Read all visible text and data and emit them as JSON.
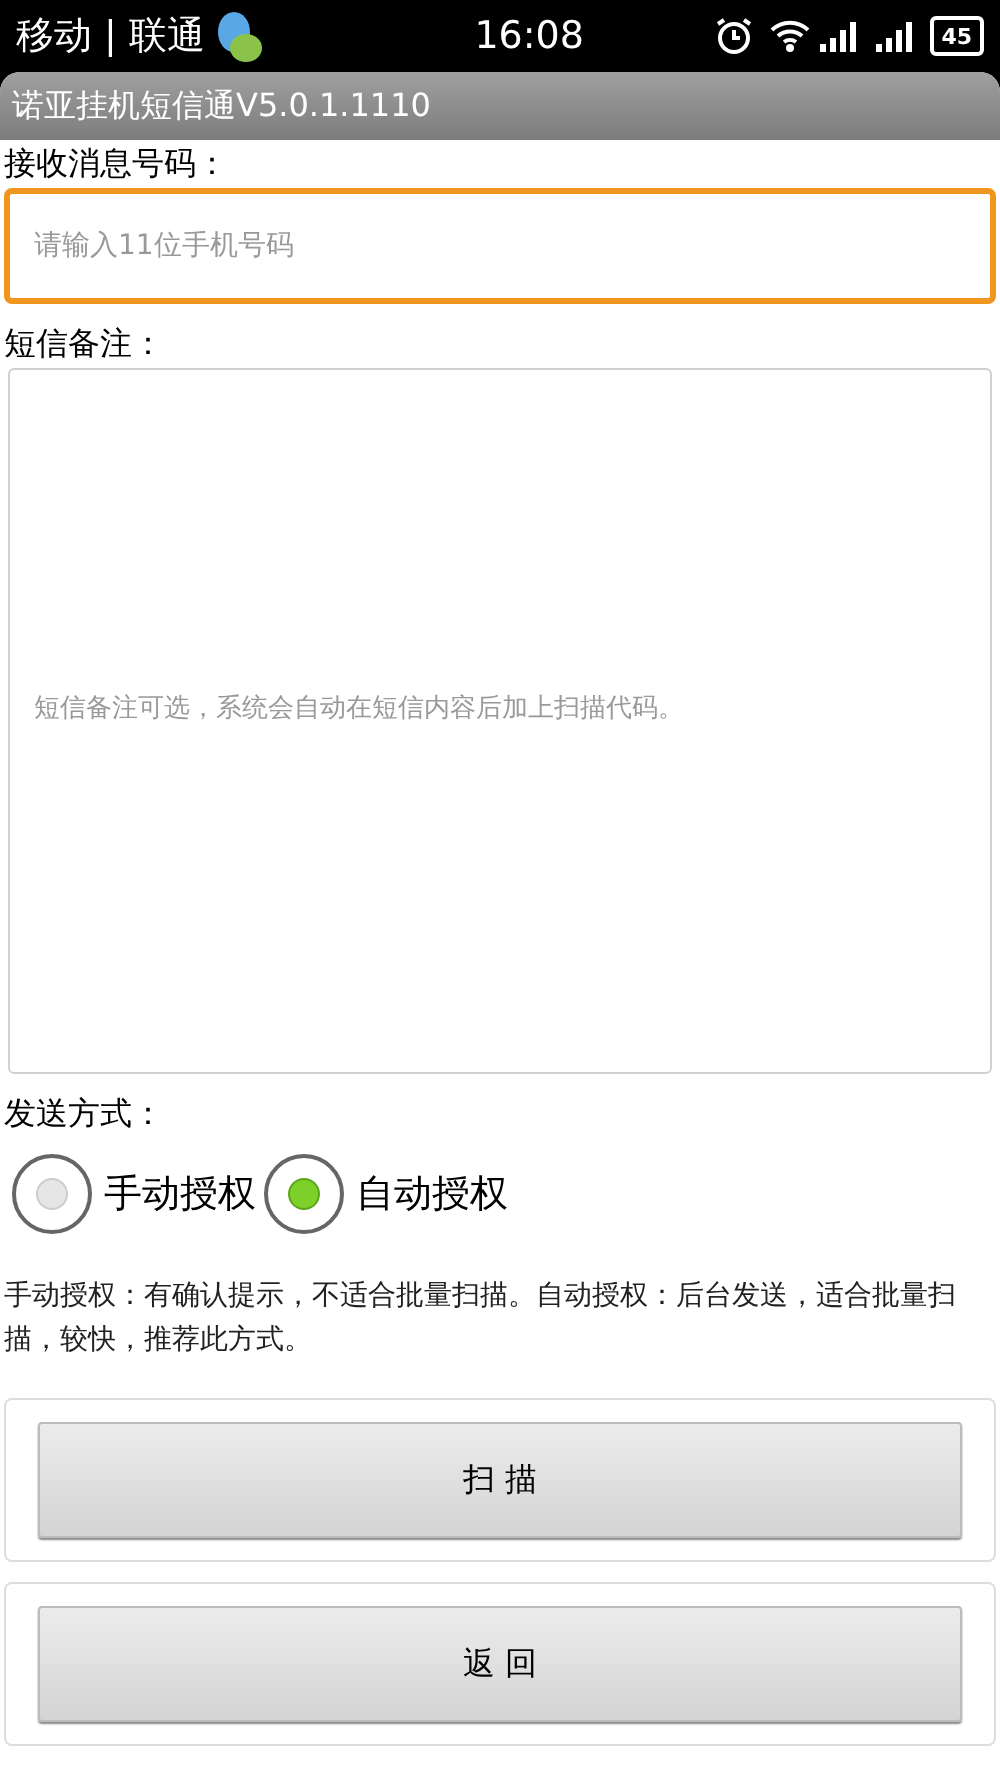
{
  "status_bar": {
    "carrier": "移动 | 联通",
    "time": "16:08",
    "battery": "45"
  },
  "window": {
    "title": "诺亚挂机短信通V5.0.1.1110"
  },
  "phone": {
    "label": "接收消息号码：",
    "placeholder": "请输入11位手机号码",
    "focused": true
  },
  "note": {
    "label": "短信备注：",
    "placeholder": "短信备注可选，系统会自动在短信内容后加上扫描代码。"
  },
  "send_mode": {
    "label": "发送方式：",
    "options": [
      {
        "label": "手动授权",
        "selected": false
      },
      {
        "label": "自动授权",
        "selected": true
      }
    ]
  },
  "help_text": "手动授权：有确认提示，不适合批量扫描。自动授权：后台发送，适合批量扫描，较快，推荐此方式。",
  "buttons": [
    {
      "label": "扫 描"
    },
    {
      "label": "返 回"
    }
  ]
}
